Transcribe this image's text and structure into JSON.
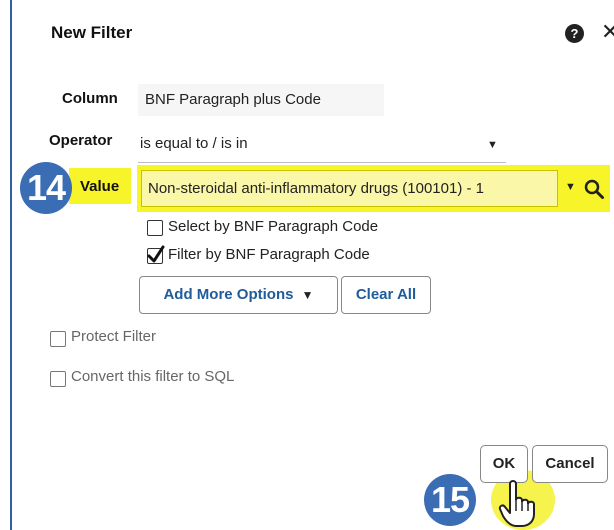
{
  "dialog": {
    "title": "New Filter",
    "help": "?",
    "close": "✕"
  },
  "form": {
    "column_label": "Column",
    "column_value": "BNF Paragraph plus Code",
    "operator_label": "Operator",
    "operator_value": "is equal to / is in",
    "value_label": "Value",
    "value_value": "Non-steroidal anti-inflammatory drugs (100101) - 1"
  },
  "options": {
    "select_by_code": {
      "label": "Select by BNF Paragraph Code",
      "checked": false
    },
    "filter_by_code": {
      "label": "Filter by BNF Paragraph Code",
      "checked": true
    },
    "add_more_options": "Add More Options",
    "clear_all": "Clear All",
    "protect_filter": {
      "label": "Protect Filter",
      "checked": false
    },
    "convert_sql": {
      "label": "Convert this filter to SQL",
      "checked": false
    }
  },
  "footer": {
    "ok": "OK",
    "cancel": "Cancel"
  },
  "annotations": {
    "step_value": "14",
    "step_ok": "15"
  },
  "colors": {
    "highlight": "#f7f42a",
    "badge": "#3a6db3",
    "link": "#1f5c99"
  },
  "icons": {
    "value_dropdown": "caret-down-icon",
    "value_search": "search-icon",
    "ok_pointer": "hand-pointer-icon"
  }
}
